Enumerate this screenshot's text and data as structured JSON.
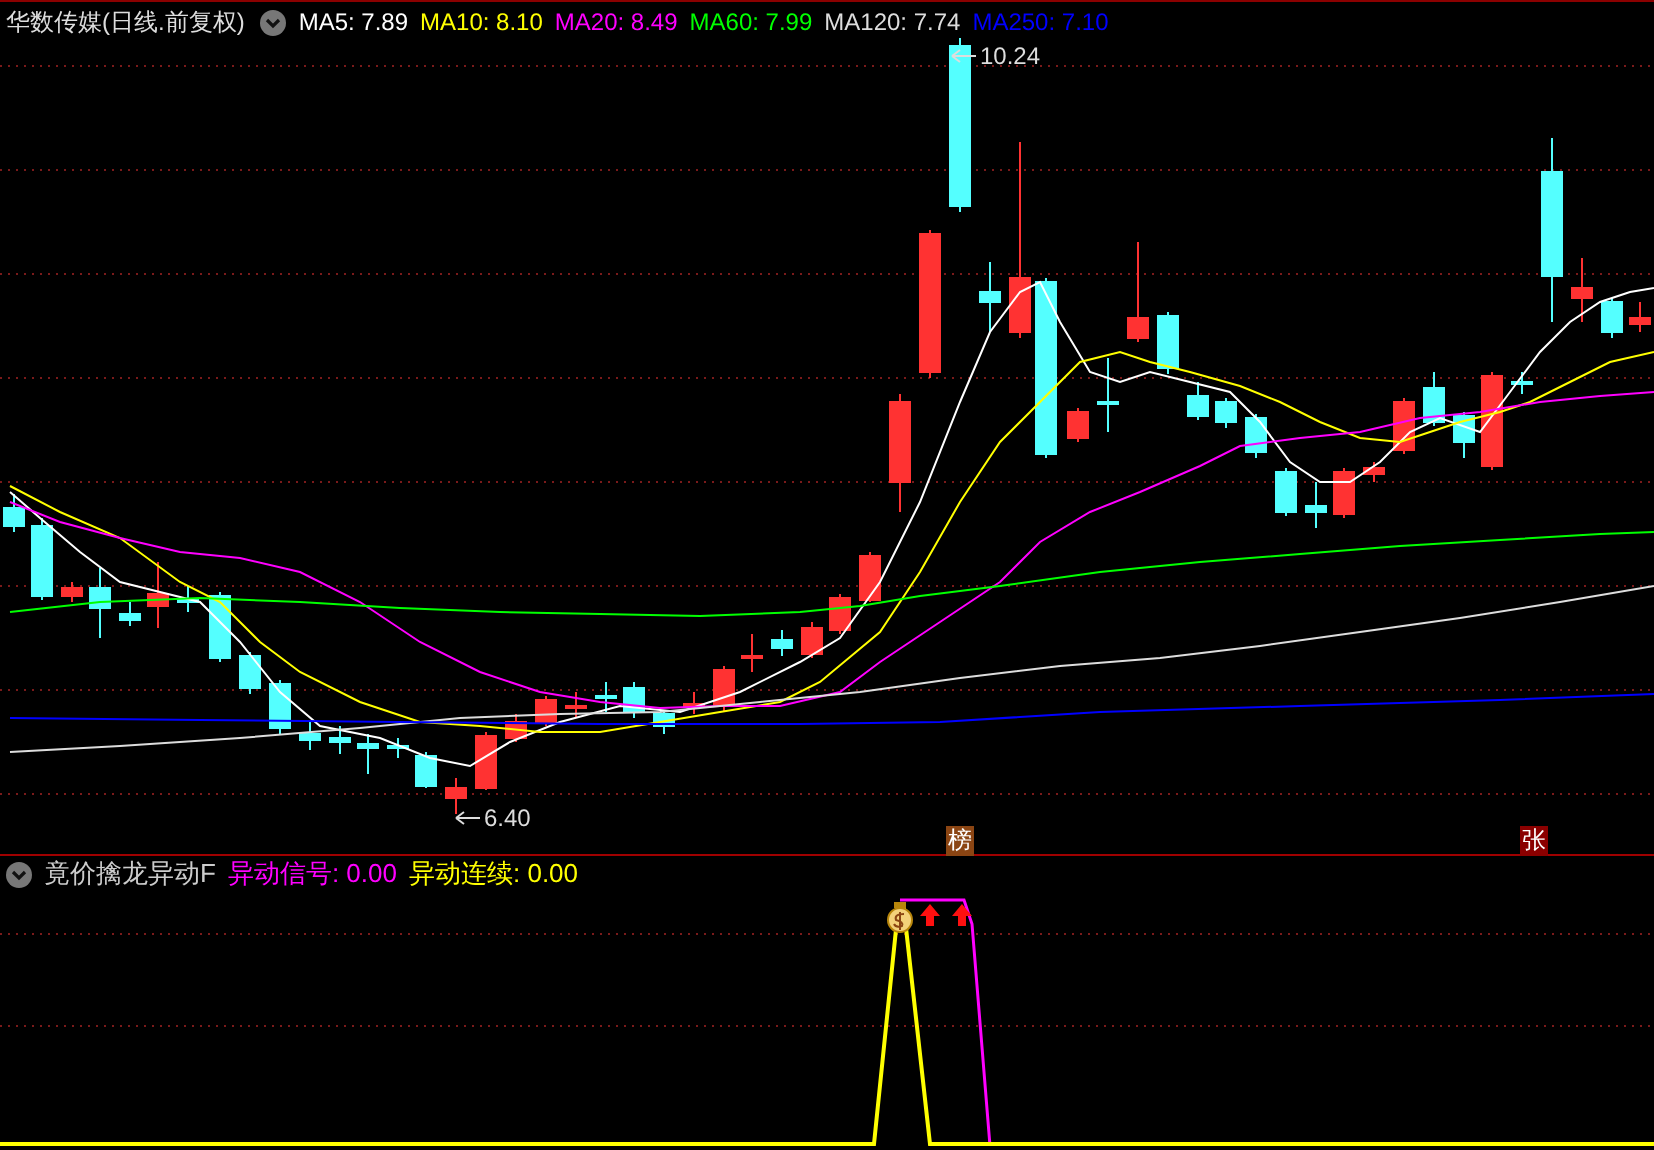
{
  "title": "华数传媒(日线.前复权)",
  "ma_legend": [
    {
      "label": "MA5: 7.89",
      "color": "#ffffff"
    },
    {
      "label": "MA10: 8.10",
      "color": "#ffff00"
    },
    {
      "label": "MA20: 8.49",
      "color": "#ff00ff"
    },
    {
      "label": "MA60: 7.99",
      "color": "#00ff00"
    },
    {
      "label": "MA120: 7.74",
      "color": "#dddddd"
    },
    {
      "label": "MA250: 7.10",
      "color": "#0000ff"
    }
  ],
  "price_labels": {
    "high": "10.24",
    "low": "6.40"
  },
  "badges": [
    {
      "text": "榜",
      "color": "#8b4513"
    },
    {
      "text": "张",
      "color": "#8b0000"
    }
  ],
  "indicator": {
    "title": "竟价擒龙异动F",
    "values": [
      {
        "label": "异动信号: 0.00",
        "color": "#ff00ff"
      },
      {
        "label": "异动连续: 0.00",
        "color": "#ffff00"
      }
    ]
  }
}
